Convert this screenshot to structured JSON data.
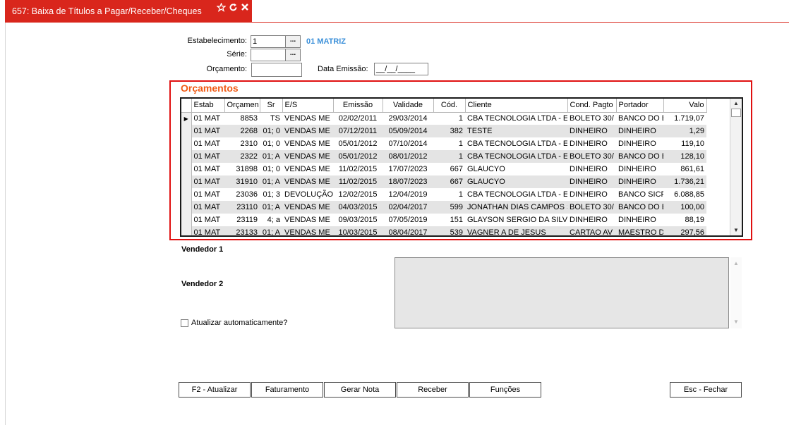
{
  "window": {
    "title": "657: Baixa de Títulos a Pagar/Receber/Cheques",
    "accent_color": "#d9261c",
    "icons": [
      "star-icon",
      "refresh-icon",
      "close-icon"
    ]
  },
  "form": {
    "estabelecimento_label": "Estabelecimento:",
    "estabelecimento_value": "1",
    "estabelecimento_name": "01 MATRIZ",
    "serie_label": "Série:",
    "serie_value": "",
    "orcamento_label": "Orçamento:",
    "orcamento_value": "",
    "data_emissao_label": "Data Emissão:",
    "data_emissao_value": "__/__/____",
    "lookup_button": "..."
  },
  "orcamentos": {
    "title": "Orçamentos",
    "columns": [
      "Estab",
      "Orçamen",
      "Sr",
      "E/S",
      "Emissão",
      "Validade",
      "Cód.",
      "Cliente",
      "Cond. Pagto",
      "Portador",
      "Valo"
    ],
    "rows": [
      [
        "01 MAT",
        "8853",
        "TS",
        "VENDAS ME",
        "02/02/2011",
        "29/03/2014",
        "1",
        "CBA TECNOLOGIA LTDA - E",
        "BOLETO 30/",
        "BANCO DO B",
        "1.719,07"
      ],
      [
        "01 MAT",
        "2268",
        "01; 0",
        "VENDAS ME",
        "07/12/2011",
        "05/09/2014",
        "382",
        "TESTE",
        "DINHEIRO",
        "DINHEIRO",
        "1,29"
      ],
      [
        "01 MAT",
        "2310",
        "01; 0",
        "VENDAS ME",
        "05/01/2012",
        "07/10/2014",
        "1",
        "CBA TECNOLOGIA LTDA - E",
        "DINHEIRO",
        "DINHEIRO",
        "119,10"
      ],
      [
        "01 MAT",
        "2322",
        "01; A",
        "VENDAS ME",
        "05/01/2012",
        "08/01/2012",
        "1",
        "CBA TECNOLOGIA LTDA - E",
        "BOLETO 30/",
        "BANCO DO B",
        "128,10"
      ],
      [
        "01 MAT",
        "31898",
        "01; 0",
        "VENDAS ME",
        "11/02/2015",
        "17/07/2023",
        "667",
        "GLAUCYO",
        "DINHEIRO",
        "DINHEIRO",
        "861,61"
      ],
      [
        "01 MAT",
        "31910",
        "01; A",
        "VENDAS ME",
        "11/02/2015",
        "18/07/2023",
        "667",
        "GLAUCYO",
        "DINHEIRO",
        "DINHEIRO",
        "1.736,21"
      ],
      [
        "01 MAT",
        "23036",
        "01; 3",
        "DEVOLUÇÃO",
        "12/02/2015",
        "12/04/2019",
        "1",
        "CBA TECNOLOGIA LTDA - E",
        "DINHEIRO",
        "BANCO SICR",
        "6.088,85"
      ],
      [
        "01 MAT",
        "23110",
        "01; A",
        "VENDAS ME",
        "04/03/2015",
        "02/04/2017",
        "599",
        "JONATHAN DIAS CAMPOS S",
        "BOLETO 30/",
        "BANCO DO B",
        "100,00"
      ],
      [
        "01 MAT",
        "23119",
        "4; a",
        "VENDAS ME",
        "09/03/2015",
        "07/05/2019",
        "151",
        "GLAYSON SERGIO DA SILV",
        "DINHEIRO",
        "DINHEIRO",
        "88,19"
      ],
      [
        "01 MAT",
        "23133",
        "01; A",
        "VENDAS ME",
        "10/03/2015",
        "08/04/2017",
        "539",
        "VAGNER A DE JESUS",
        "CARTAO AV",
        "MAESTRO D",
        "297,56"
      ]
    ]
  },
  "vendedor1_label": "Vendedor 1",
  "vendedor2_label": "Vendedor 2",
  "atualizar_label": "Atualizar automaticamente?",
  "buttons": {
    "atualizar": "F2 - Atualizar",
    "faturamento": "Faturamento",
    "gerar_nota": "Gerar Nota",
    "receber": "Receber",
    "funcoes": "Funções",
    "fechar": "Esc - Fechar"
  }
}
